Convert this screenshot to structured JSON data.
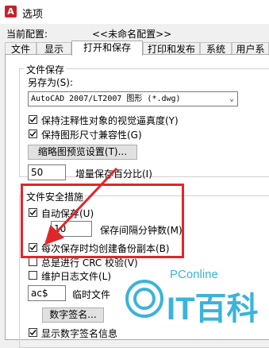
{
  "window": {
    "title": "选项"
  },
  "profile": {
    "label": "当前配置:",
    "value": "<<未命名配置>>"
  },
  "tabs": [
    {
      "label": "文件"
    },
    {
      "label": "显示"
    },
    {
      "label": "打开和保存"
    },
    {
      "label": "打印和发布"
    },
    {
      "label": "系统"
    },
    {
      "label": "用户系统"
    }
  ],
  "file_save": {
    "title": "文件保存",
    "save_as_label": "另存为(S):",
    "save_as_value": "AutoCAD 2007/LT2007 图形 (*.dwg)",
    "keep_annotative": "保持注释性对象的视觉逼真度(Y)",
    "keep_drawing_size": "保持图形尺寸兼容性(G)",
    "thumbnail_button": "缩略图预览设置(T)...",
    "incremental_value": "50",
    "incremental_label": "增量保存百分比(I)"
  },
  "file_safety": {
    "title": "文件安全措施",
    "autosave_label": "自动保存(U)",
    "autosave_minutes_value": "10",
    "autosave_minutes_label": "保存间隔分钟数(M)",
    "backup_label": "每次保存时均创建备份副本(B)",
    "crc_label": "总是进行 CRC 校验(V)",
    "log_label": "维护日志文件(L)",
    "temp_ext_value": "ac$",
    "temp_ext_label": "临时文件",
    "digital_sig_button": "数字签名...",
    "display_sig_label": "显示数字签名信息"
  },
  "watermark": {
    "brand": "PConline",
    "logo_text": "IT百科"
  },
  "colors": {
    "highlight": "#e0262b",
    "watermark": "#1aa6d4"
  }
}
